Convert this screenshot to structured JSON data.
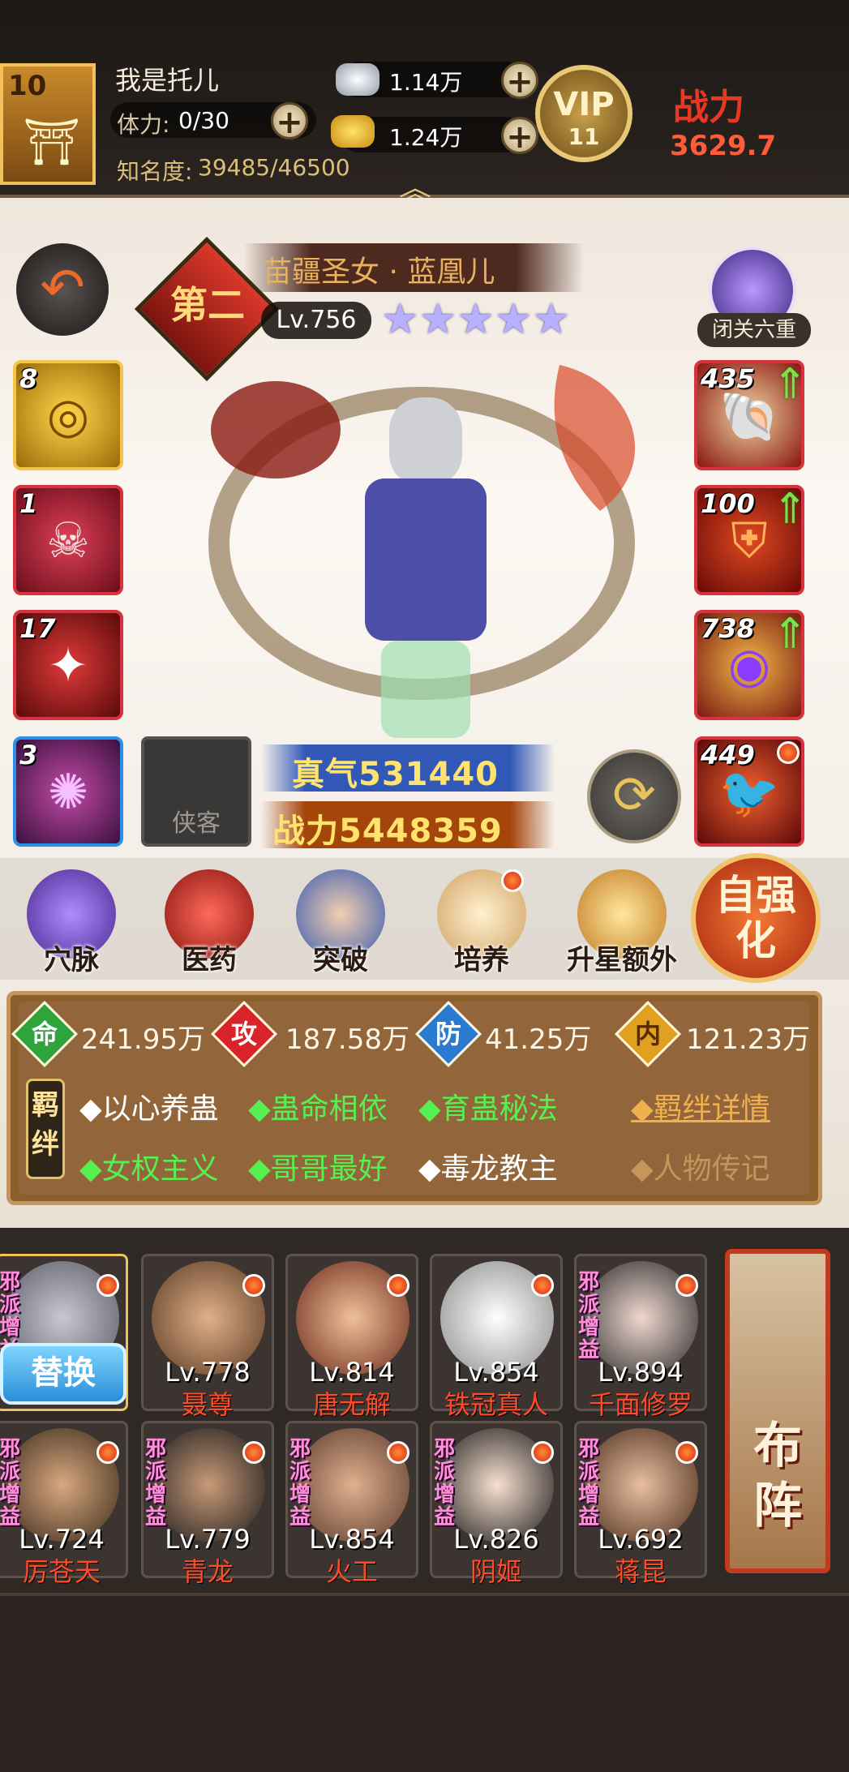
{
  "header": {
    "level": "10",
    "player_name": "我是托儿",
    "stamina_label": "体力:",
    "stamina_value": "0/30",
    "fame_label": "知名度:",
    "fame_value": "39485/46500",
    "silver": "1.14万",
    "gold": "1.24万",
    "vip_label": "VIP",
    "vip_level": "11",
    "battle_power_label": "战力",
    "battle_power_partial": "3629.7"
  },
  "hero": {
    "title": "苗疆圣女 · 蓝凰儿",
    "rank": "第二",
    "level": "Lv.756",
    "stars": 5,
    "seclusion_label": "闭关六重",
    "zhenqi": "真气531440",
    "zhanli": "战力5448359",
    "xiake_label": "侠客"
  },
  "left_slots": [
    {
      "count": "8"
    },
    {
      "count": "1"
    },
    {
      "count": "17"
    },
    {
      "count": "3"
    }
  ],
  "right_slots": [
    {
      "count": "435"
    },
    {
      "count": "100"
    },
    {
      "count": "738"
    },
    {
      "count": "449"
    }
  ],
  "functions": [
    {
      "label": "穴脉"
    },
    {
      "label": "医药"
    },
    {
      "label": "突破"
    },
    {
      "label": "培养"
    },
    {
      "label": "升星额外"
    }
  ],
  "self_strengthen": "自强化",
  "attributes": [
    {
      "icon": "命",
      "value": "241.95万",
      "color": "#2fa33c"
    },
    {
      "icon": "攻",
      "value": "187.58万",
      "color": "#d8232a"
    },
    {
      "icon": "防",
      "value": "41.25万",
      "color": "#2a7bd0"
    },
    {
      "icon": "内",
      "value": "121.23万",
      "color": "#e0a020"
    }
  ],
  "bonds": {
    "tag": "羁绊",
    "row1": [
      {
        "text": "◆以心养蛊",
        "active": false
      },
      {
        "text": "◆蛊命相依",
        "active": true
      },
      {
        "text": "◆育蛊秘法",
        "active": true
      }
    ],
    "row2": [
      {
        "text": "◆女权主义",
        "active": true
      },
      {
        "text": "◆哥哥最好",
        "active": true
      },
      {
        "text": "◆毒龙教主",
        "active": false
      }
    ],
    "detail_link": "◆羁绊详情",
    "bio_link": "◆人物传记"
  },
  "hero_list": {
    "swap_button": "替换",
    "row1": [
      {
        "level": "Lv.778",
        "name": "聂尊",
        "tag": ""
      },
      {
        "level": "Lv.814",
        "name": "唐无解",
        "tag": ""
      },
      {
        "level": "Lv.854",
        "name": "铁冠真人",
        "tag": ""
      },
      {
        "level": "Lv.894",
        "name": "千面修罗",
        "tag": "邪派增益"
      }
    ],
    "row2": [
      {
        "level": "Lv.724",
        "name": "厉苍天",
        "tag": "邪派增益"
      },
      {
        "level": "Lv.779",
        "name": "青龙",
        "tag": "邪派增益"
      },
      {
        "level": "Lv.854",
        "name": "火工",
        "tag": "邪派增益"
      },
      {
        "level": "Lv.826",
        "name": "阴姬",
        "tag": "邪派增益"
      },
      {
        "level": "Lv.692",
        "name": "蒋昆",
        "tag": "邪派增益"
      }
    ],
    "first_card_tag": "邪派增益",
    "formation_label": "布阵"
  }
}
